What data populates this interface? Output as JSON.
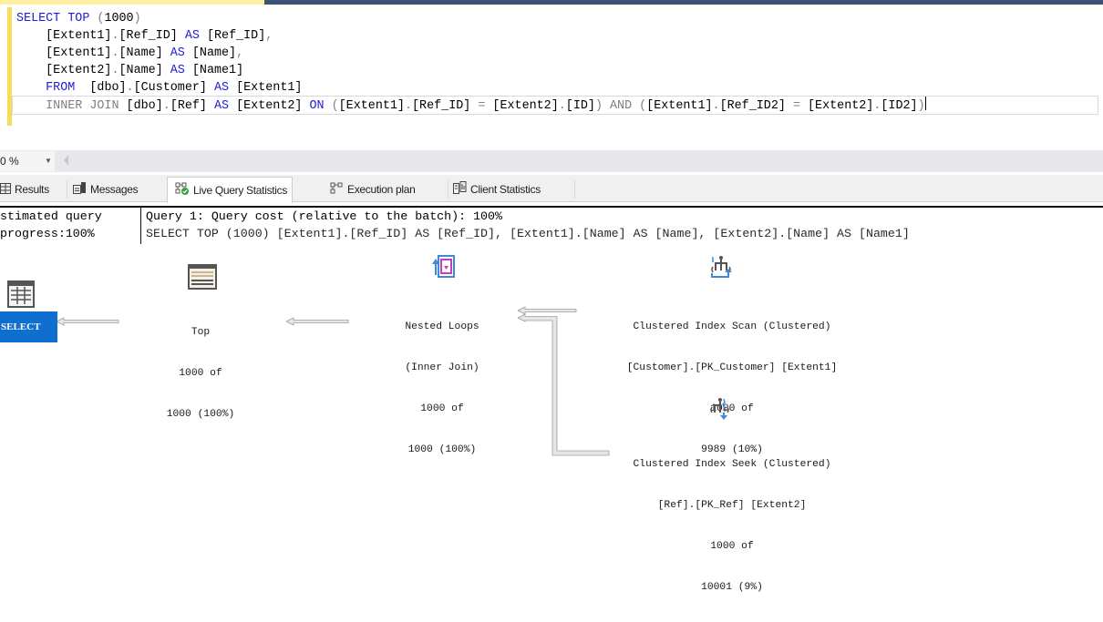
{
  "editor": {
    "lines": [
      [
        {
          "t": "SELECT TOP ",
          "c": "kw"
        },
        {
          "t": "(",
          "c": "gray"
        },
        {
          "t": "1000",
          "c": ""
        },
        {
          "t": ")",
          "c": "gray"
        }
      ],
      [
        {
          "t": "    [Extent1]",
          "c": ""
        },
        {
          "t": ".",
          "c": "gray"
        },
        {
          "t": "[Ref_ID] ",
          "c": ""
        },
        {
          "t": "AS",
          "c": "kw"
        },
        {
          "t": " [Ref_ID]",
          "c": ""
        },
        {
          "t": ",",
          "c": "gray"
        }
      ],
      [
        {
          "t": "    [Extent1]",
          "c": ""
        },
        {
          "t": ".",
          "c": "gray"
        },
        {
          "t": "[Name] ",
          "c": ""
        },
        {
          "t": "AS",
          "c": "kw"
        },
        {
          "t": " [Name]",
          "c": ""
        },
        {
          "t": ",",
          "c": "gray"
        }
      ],
      [
        {
          "t": "    [Extent2]",
          "c": ""
        },
        {
          "t": ".",
          "c": "gray"
        },
        {
          "t": "[Name] ",
          "c": ""
        },
        {
          "t": "AS",
          "c": "kw"
        },
        {
          "t": " [Name1]",
          "c": ""
        }
      ],
      [
        {
          "t": "    FROM",
          "c": "kw"
        },
        {
          "t": "  [dbo]",
          "c": ""
        },
        {
          "t": ".",
          "c": "gray"
        },
        {
          "t": "[Customer] ",
          "c": ""
        },
        {
          "t": "AS",
          "c": "kw"
        },
        {
          "t": " [Extent1]",
          "c": ""
        }
      ],
      [
        {
          "t": "    INNER JOIN ",
          "c": "gray"
        },
        {
          "t": "[dbo]",
          "c": ""
        },
        {
          "t": ".",
          "c": "gray"
        },
        {
          "t": "[Ref] ",
          "c": ""
        },
        {
          "t": "AS",
          "c": "kw"
        },
        {
          "t": " [Extent2] ",
          "c": ""
        },
        {
          "t": "ON",
          "c": "kw"
        },
        {
          "t": " (",
          "c": "gray"
        },
        {
          "t": "[Extent1]",
          "c": ""
        },
        {
          "t": ".",
          "c": "gray"
        },
        {
          "t": "[Ref_ID] ",
          "c": ""
        },
        {
          "t": "=",
          "c": "gray"
        },
        {
          "t": " [Extent2]",
          "c": ""
        },
        {
          "t": ".",
          "c": "gray"
        },
        {
          "t": "[ID]",
          "c": ""
        },
        {
          "t": ") AND (",
          "c": "gray"
        },
        {
          "t": "[Extent1]",
          "c": ""
        },
        {
          "t": ".",
          "c": "gray"
        },
        {
          "t": "[Ref_ID2] ",
          "c": ""
        },
        {
          "t": "=",
          "c": "gray"
        },
        {
          "t": " [Extent2]",
          "c": ""
        },
        {
          "t": ".",
          "c": "gray"
        },
        {
          "t": "[ID2]",
          "c": ""
        },
        {
          "t": ")",
          "c": "gray"
        }
      ]
    ]
  },
  "zoom": {
    "value": "0 %"
  },
  "result_tabs": [
    {
      "label": "Results",
      "icon": "grid-icon"
    },
    {
      "label": "Messages",
      "icon": "messages-icon"
    },
    {
      "label": "Live Query Statistics",
      "icon": "live-stats-icon",
      "active": true
    },
    {
      "label": "Execution plan",
      "icon": "execution-plan-icon"
    },
    {
      "label": "Client Statistics",
      "icon": "client-statistics-icon"
    }
  ],
  "plan_header": {
    "left_line1": "stimated query",
    "left_line2": "progress:100%",
    "right_line1": "Query 1: Query cost (relative to the batch): 100%",
    "right_line2": "SELECT TOP (1000) [Extent1].[Ref_ID] AS [Ref_ID], [Extent1].[Name] AS [Name], [Extent2].[Name] AS [Name1]"
  },
  "plan_nodes": {
    "select": {
      "label": "SELECT"
    },
    "top": {
      "lines": [
        "Top",
        "1000 of",
        "1000 (100%)"
      ]
    },
    "nested_loops": {
      "lines": [
        "Nested Loops",
        "(Inner Join)",
        "1000 of",
        "1000 (100%)"
      ]
    },
    "index_scan": {
      "lines": [
        "Clustered Index Scan (Clustered)",
        "[Customer].[PK_Customer] [Extent1]",
        "1000 of",
        "9989 (10%)"
      ]
    },
    "index_seek": {
      "lines": [
        "Clustered Index Seek (Clustered)",
        "[Ref].[PK_Ref] [Extent2]",
        "1000 of",
        "10001 (9%)"
      ]
    }
  }
}
